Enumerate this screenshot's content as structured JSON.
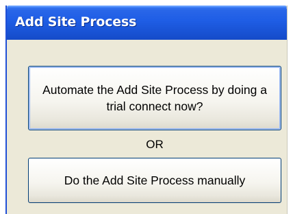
{
  "window": {
    "title": "Add Site Process"
  },
  "dialog": {
    "automate_button_label": "Automate the Add Site Process by doing a trial connect now?",
    "or_label": "OR",
    "manual_button_label": "Do the Add Site Process manually"
  },
  "colors": {
    "titlebar_blue": "#1f5ee6",
    "dialog_background": "#ece9d8",
    "button_border": "#003c74"
  }
}
